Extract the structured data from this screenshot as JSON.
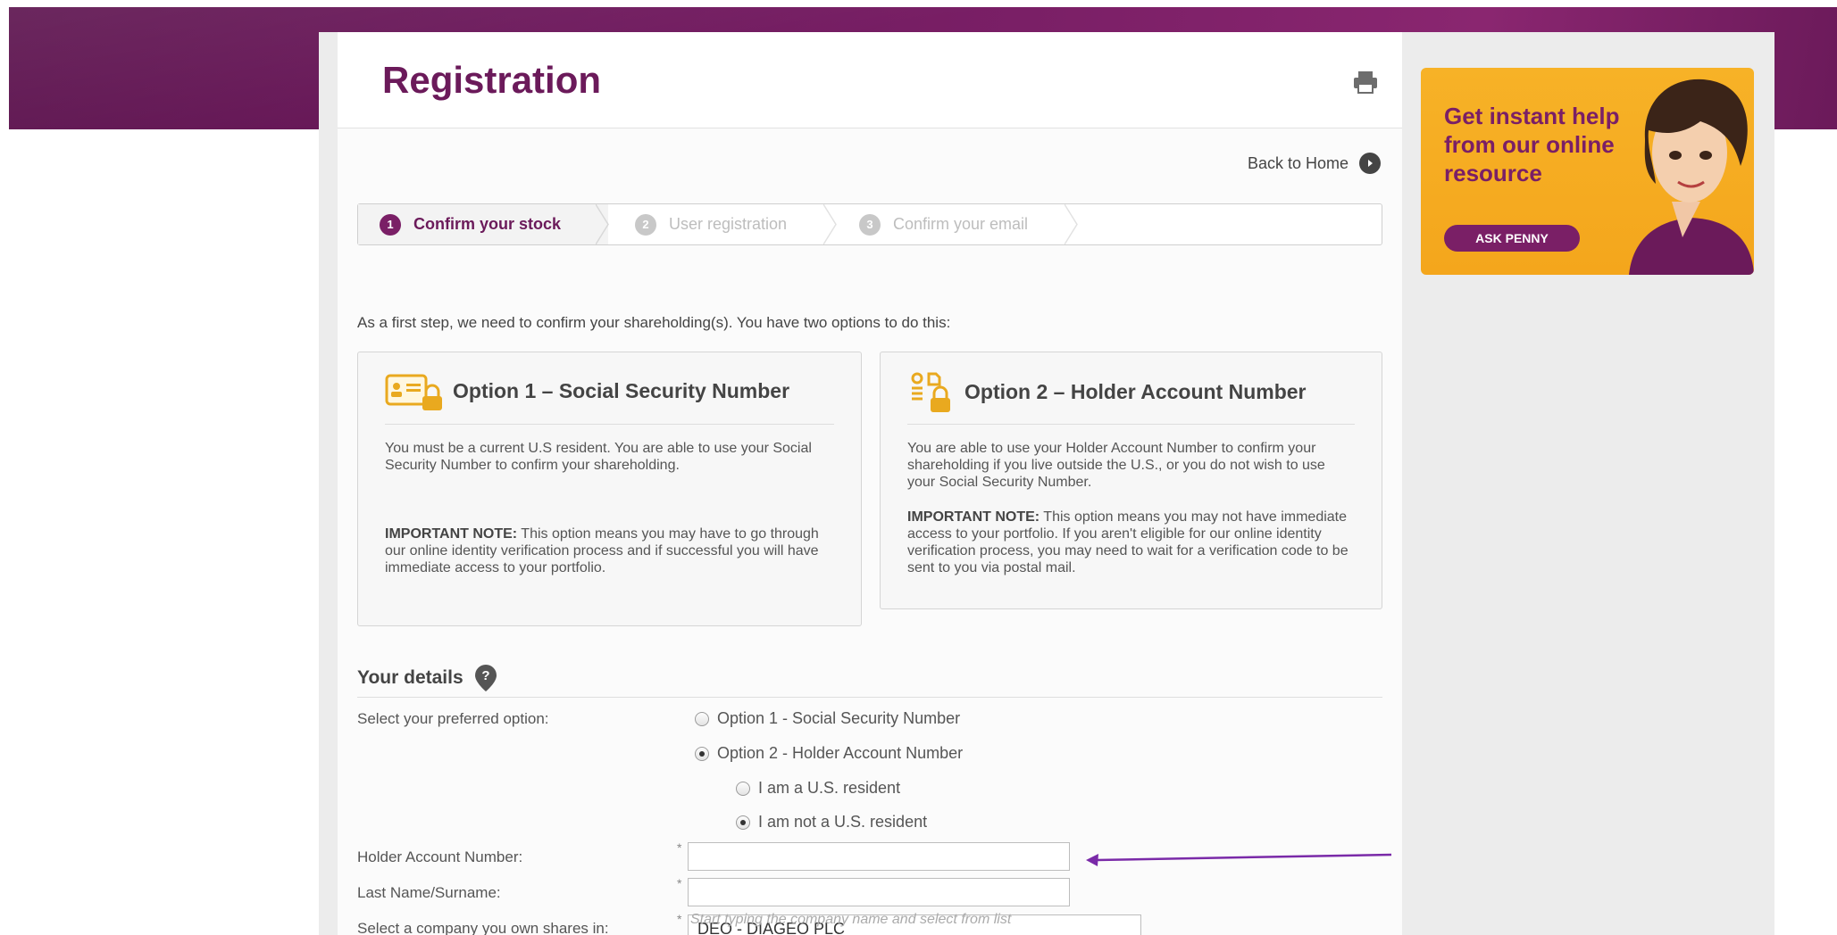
{
  "header": {
    "title": "Registration",
    "back_home": "Back to Home"
  },
  "stepper": {
    "steps": [
      {
        "num": "1",
        "label": "Confirm your stock"
      },
      {
        "num": "2",
        "label": "User registration"
      },
      {
        "num": "3",
        "label": "Confirm your email"
      }
    ]
  },
  "intro": "As a first step, we need to confirm your shareholding(s). You have two options to do this:",
  "option1": {
    "title": "Option 1 – Social Security Number",
    "body": "You must be a current U.S resident. You are able to use your Social Security Number to confirm your shareholding.",
    "note_label": "IMPORTANT NOTE:",
    "note": " This option means you may have to go through our online identity verification process and if successful you will have immediate access to your portfolio."
  },
  "option2": {
    "title": "Option 2 – Holder Account Number",
    "body": "You are able to use your Holder Account Number to confirm your shareholding if you live outside the U.S., or you do not wish to use your Social Security Number.",
    "note_label": "IMPORTANT NOTE:",
    "note": " This option means you may not have immediate access to your portfolio. If you aren't eligible for our online identity verification process, you may need to wait for a verification code to be sent to you via postal mail."
  },
  "details": {
    "title": "Your details",
    "select_label": "Select your preferred option:",
    "radio_opt1": "Option 1 - Social Security Number",
    "radio_opt2": "Option 2 - Holder Account Number",
    "radio_us": "I am a U.S. resident",
    "radio_not_us": "I am not a U.S. resident",
    "selected_option": "Option 2 - Holder Account Number",
    "selected_residency": "I am not a U.S. resident",
    "holder_label": "Holder Account Number:",
    "holder_value": "",
    "lastname_label": "Last Name/Surname:",
    "lastname_value": "",
    "company_label": "Select a company you own shares in:",
    "company_value": "DEO - DIAGEO PLC",
    "company_hint": "Start typing the company name and select from list",
    "required_mark": "*"
  },
  "ad": {
    "text": "Get instant help from our online resource",
    "button": "ASK PENNY"
  },
  "colors": {
    "brand_purple": "#6b1a5a",
    "ad_orange": "#f4a61c",
    "icon_gold": "#e9a91f"
  }
}
